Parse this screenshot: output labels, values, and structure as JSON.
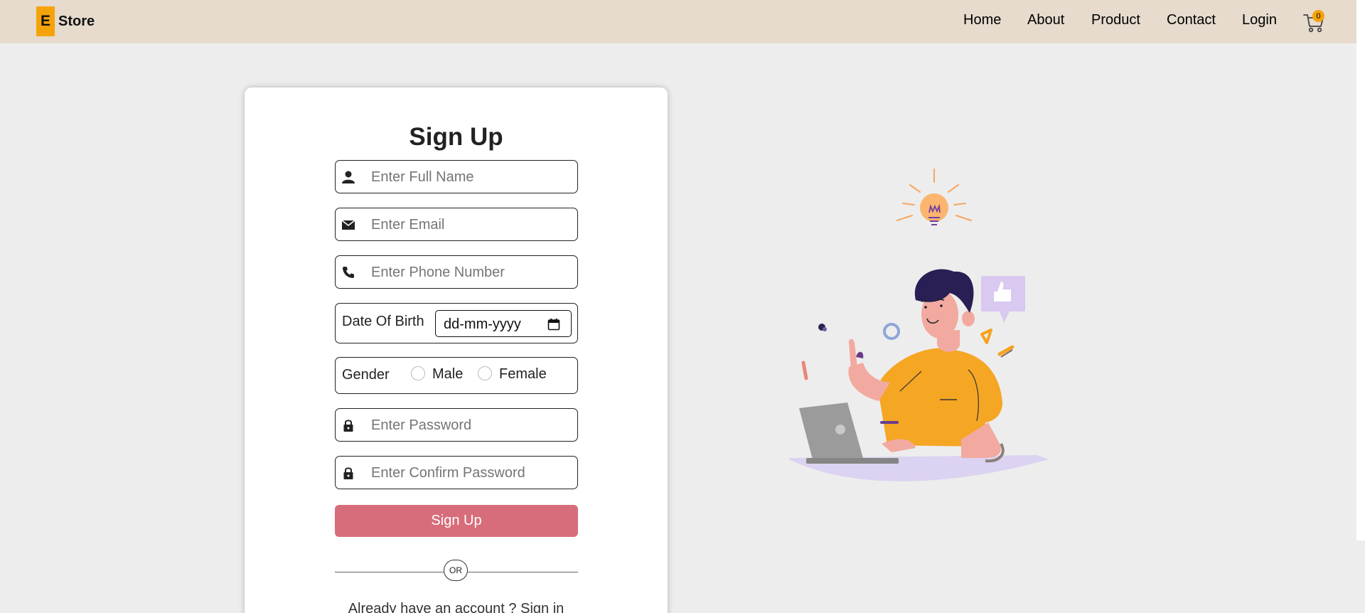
{
  "brand": {
    "mark": "E",
    "name": "Store",
    "accent": "#f5a30a"
  },
  "nav": {
    "links": [
      "Home",
      "About",
      "Product",
      "Contact",
      "Login"
    ],
    "cart_icon": "cart-icon",
    "cart_count": "0"
  },
  "form": {
    "title": "Sign Up",
    "full_name": {
      "placeholder": "Enter Full Name",
      "icon": "user-icon"
    },
    "email": {
      "placeholder": "Enter Email",
      "icon": "envelope-icon"
    },
    "phone": {
      "placeholder": "Enter Phone Number",
      "icon": "phone-icon"
    },
    "dob": {
      "label": "Date Of Birth",
      "value": "dd-mm-yyyy",
      "icon": "calendar-icon"
    },
    "gender": {
      "label": "Gender",
      "options": [
        "Male",
        "Female"
      ]
    },
    "password": {
      "placeholder": "Enter Password",
      "icon": "lock-icon"
    },
    "confirm_password": {
      "placeholder": "Enter Confirm Password",
      "icon": "lock-icon"
    },
    "submit_label": "Sign Up",
    "submit_color": "#d76d7b",
    "divider_label": "OR",
    "signin_text": "Already have an account ? Sign in"
  },
  "colors": {
    "navbar": "#e6dbcd",
    "page": "#ededed",
    "card": "#ffffff"
  }
}
